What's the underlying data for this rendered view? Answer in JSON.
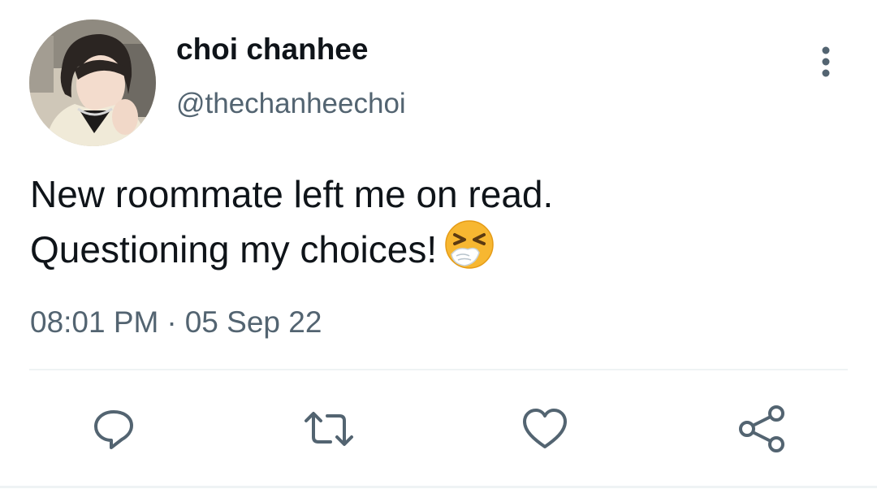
{
  "tweet": {
    "author": {
      "display_name": "choi chanhee",
      "handle": "@thechanheechoi"
    },
    "text_lines": [
      "New roommate left me on read.",
      "Questioning my choices!"
    ],
    "emoji": "sneezing-face",
    "time": "08:01 PM",
    "separator": "·",
    "date": "05 Sep 22"
  },
  "actions": {
    "reply_icon": "reply-icon",
    "retweet_icon": "retweet-icon",
    "like_icon": "heart-icon",
    "share_icon": "share-icon"
  },
  "menu_icon": "more-vertical-icon",
  "colors": {
    "text": "#0f1419",
    "secondary": "#536471",
    "divider": "#eff3f4",
    "emoji_face": "#f7b731"
  }
}
